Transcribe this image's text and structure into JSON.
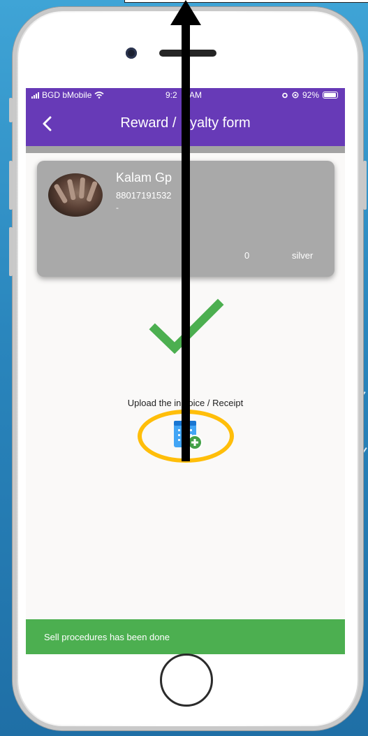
{
  "status_bar": {
    "carrier": "BGD bMobile",
    "time": "9:2",
    "time_suffix": "AM",
    "battery": "92%"
  },
  "app_bar": {
    "title_left": "Reward / ",
    "title_right": "yalty form"
  },
  "user_card": {
    "name": "Kalam Gp",
    "phone": "88017191532",
    "extra": "-",
    "points": "0",
    "tier": "silver"
  },
  "upload": {
    "label_left": "Upload the in",
    "label_right": "oice / Receipt"
  },
  "snackbar": {
    "message": "Sell procedures  has been done"
  },
  "colors": {
    "app_bar": "#673ab7",
    "check": "#4caf50",
    "snackbar": "#4caf50",
    "highlight": "#ffbe0a"
  },
  "icons": [
    "signal-icon",
    "wifi-icon",
    "alarm-icon",
    "rotation-lock-icon",
    "battery-icon",
    "back-arrow-icon",
    "checkmark-icon",
    "add-document-icon"
  ]
}
